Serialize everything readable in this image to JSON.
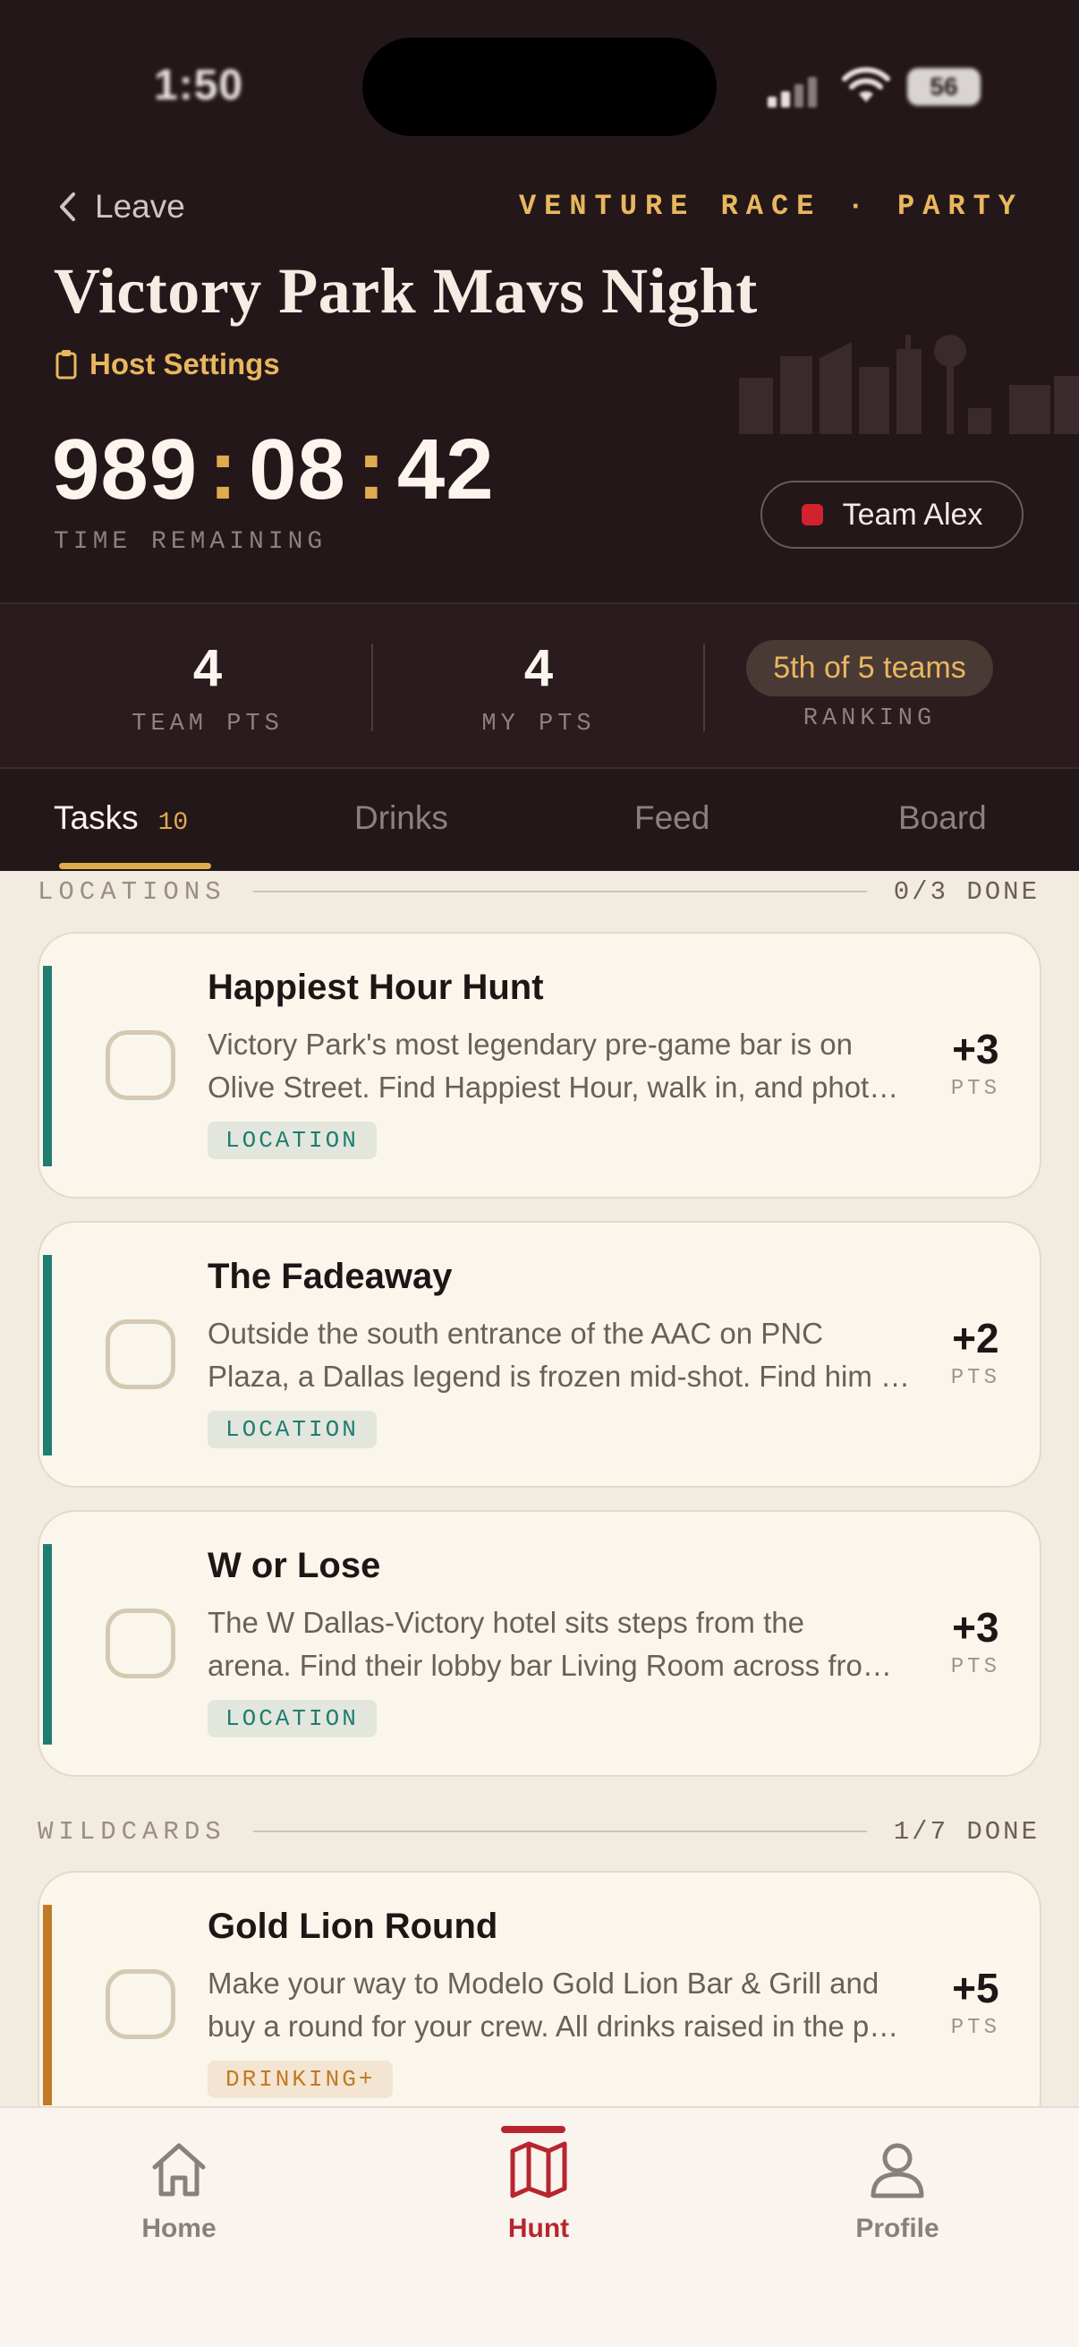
{
  "status_bar": {
    "time": "1:50",
    "battery": "56"
  },
  "header": {
    "back_label": "Leave",
    "mode": "VENTURE RACE · PARTY",
    "title": "Victory Park Mavs Night",
    "host_settings": "Host Settings",
    "timer": {
      "hours": "989",
      "minutes": "08",
      "seconds": "42",
      "separator": ":"
    },
    "timer_label": "TIME REMAINING",
    "team": {
      "name": "Team Alex",
      "color": "#d2222e"
    }
  },
  "stats": {
    "team_pts": {
      "value": "4",
      "label": "TEAM PTS"
    },
    "my_pts": {
      "value": "4",
      "label": "MY PTS"
    },
    "ranking": {
      "value": "5th of 5 teams",
      "label": "RANKING"
    }
  },
  "tabs": [
    {
      "label": "Tasks",
      "count": "10",
      "active": true
    },
    {
      "label": "Drinks"
    },
    {
      "label": "Feed"
    },
    {
      "label": "Board"
    }
  ],
  "sections": [
    {
      "title": "LOCATIONS",
      "progress": "0/3 DONE",
      "tasks": [
        {
          "title": "Happiest Hour Hunt",
          "desc_line1": "Victory Park's most legendary pre-game bar is on",
          "desc_line2": "Olive Street. Find Happiest Hour, walk in, and photograph the sign.",
          "tag": "LOCATION",
          "points": "+3",
          "points_label": "PTS"
        },
        {
          "title": "The Fadeaway",
          "desc_line1": "Outside the south entrance of the AAC on PNC",
          "desc_line2": "Plaza, a Dallas legend is frozen mid-shot. Find him and strike the pose.",
          "tag": "LOCATION",
          "points": "+2",
          "points_label": "PTS"
        },
        {
          "title": "W or Lose",
          "desc_line1": "The W Dallas-Victory hotel sits steps from the",
          "desc_line2": "arena. Find their lobby bar Living Room across from the elevators.",
          "tag": "LOCATION",
          "points": "+3",
          "points_label": "PTS"
        }
      ]
    },
    {
      "title": "WILDCARDS",
      "progress": "1/7 DONE",
      "tasks": [
        {
          "title": "Gold Lion Round",
          "desc_line1": "Make your way to Modelo Gold Lion Bar & Grill and",
          "desc_line2": "buy a round for your crew. All drinks raised in the photo.",
          "tag": "DRINKING+",
          "points": "+5",
          "points_label": "PTS"
        }
      ]
    }
  ],
  "bottom_nav": [
    {
      "label": "Home",
      "icon": "house-icon"
    },
    {
      "label": "Hunt",
      "icon": "map-icon",
      "active": true
    },
    {
      "label": "Profile",
      "icon": "person-icon"
    }
  ],
  "colors": {
    "header_bg": "#241719",
    "gold": "#e0aa4e",
    "teal": "#1f7d72",
    "amber": "#c27a24",
    "active_red": "#b8252f",
    "page_bg": "#f2ebdf"
  }
}
